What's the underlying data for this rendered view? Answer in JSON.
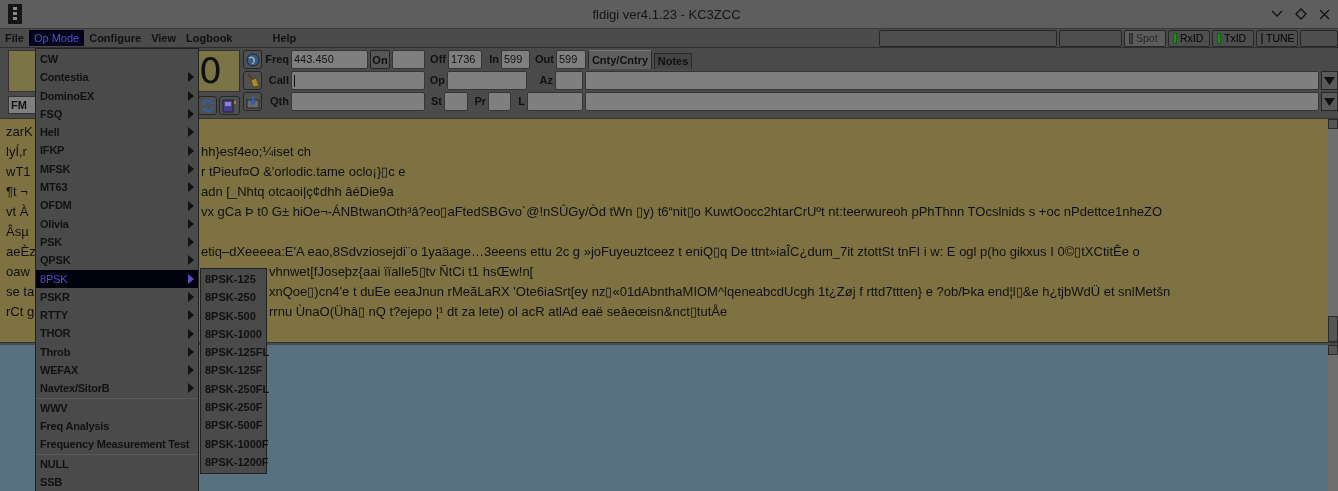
{
  "window": {
    "title": "fldigi ver4.1.23 - KC3ZCC"
  },
  "menu_bar": [
    {
      "label": "File",
      "selected": false
    },
    {
      "label": "Op Mode",
      "selected": true
    },
    {
      "label": "Configure",
      "selected": false
    },
    {
      "label": "View",
      "selected": false
    },
    {
      "label": "Logbook",
      "selected": false
    },
    {
      "label": "Help",
      "selected": false
    }
  ],
  "toolbar_buttons": [
    {
      "kind": "blank"
    },
    {
      "kind": "blank"
    },
    {
      "kind": "toggle",
      "label": "Spot",
      "on": false,
      "disabled": true
    },
    {
      "kind": "toggle",
      "label": "RxID",
      "on": true,
      "disabled": false
    },
    {
      "kind": "toggle",
      "label": "TxID",
      "on": true,
      "disabled": false
    },
    {
      "kind": "toggle",
      "label": "TUNE",
      "on": false,
      "disabled": false
    },
    {
      "kind": "blank"
    }
  ],
  "frequency_display": {
    "digit": "0"
  },
  "mode_field": {
    "value": "FM"
  },
  "log_rows": [
    [
      {
        "kind": "label",
        "text": "Freq"
      },
      {
        "kind": "field",
        "value": "443.450"
      },
      {
        "kind": "button",
        "text": "On"
      },
      {
        "kind": "field"
      },
      {
        "kind": "label",
        "text": "Off"
      },
      {
        "kind": "field",
        "value": "1736"
      },
      {
        "kind": "label",
        "text": "In"
      },
      {
        "kind": "field",
        "value": "599"
      },
      {
        "kind": "label",
        "text": "Out"
      },
      {
        "kind": "field",
        "value": "599"
      },
      {
        "kind": "tab",
        "text": "Cnty/Cntry",
        "selected": true
      },
      {
        "kind": "tab",
        "text": "Notes",
        "selected": false
      }
    ],
    [
      {
        "kind": "label",
        "text": "Call"
      },
      {
        "kind": "field",
        "focused": true
      },
      {
        "kind": "label",
        "text": "Op"
      },
      {
        "kind": "field"
      },
      {
        "kind": "label",
        "text": "Az"
      },
      {
        "kind": "field"
      },
      {
        "kind": "combo"
      }
    ],
    [
      {
        "kind": "label",
        "text": "Qth"
      },
      {
        "kind": "field"
      },
      {
        "kind": "label",
        "text": "St"
      },
      {
        "kind": "field"
      },
      {
        "kind": "label",
        "text": "Pr"
      },
      {
        "kind": "field"
      },
      {
        "kind": "label",
        "text": "L"
      },
      {
        "kind": "field"
      },
      {
        "kind": "combo"
      }
    ]
  ],
  "receive_text": [
    {
      "left": "zarK"
    },
    {
      "left": "lyÍ,r",
      "right": "hh}esf4eo;¼iset ch"
    },
    {
      "left": "wT1",
      "right": "r tPieuf¤O  &'orlodic.tame oclo¡}▯c   e"
    },
    {
      "left": "¶t ¬",
      "right": "adn [_Nhtq otcaoi|ç¢dhh âéDie9a"
    },
    {
      "left": "vt À",
      "right": "vx gCa Þ t0 G± hiOe¬-ÁNBtwanOth³â?eo▯aFtedSBGvo`@!nSÛGy/Òd  tWn ▯y) t6“nit▯o  KuwtOocc2htarCrUºt nt:teerwureoh pPhThnn TOcslnids s +oc  nPdettce1nheZO"
    },
    {
      "left": "Âsµ"
    },
    {
      "left": "aeÈz",
      "right": "etiq–dXeeeea:E'A eao,8Sdvziosejdi¨o 1yaäage…3eeens ettu 2c g »joFuyeuztceez  t eniQ▯q  De ttnt»iaÎC¿dum_7it ztottSt tnFI  i w: E ogl p(ho gikxus I 0©▯tXCtitÊe o"
    },
    {
      "left": "oaw",
      "right": "vhnwet[fJoseþz{aai ïïalle5▯tv ÑtCi  t1 hsŒw!n["
    },
    {
      "left": "se ta",
      "right": "xnQoe▯)cn4'e t  duEe eeaJnun rMeãLaRX 'Ote6iaSrt[ey nz▯«01dAbnthaMIOM^lqeneabcdUcgh  1t¿Zøj f rttd7ttten}   e ?ob/Þka end¦l▯&e h¿tjbWdÜ et snlMetšn"
    },
    {
      "left": "rCt g",
      "right": "rrnu  ÙnaO(Ühâ▯ nQ  t?ejepo ¦¹  dt za lete) ol acR atlAd eaë seâeœisn&nct▯tutÅe"
    }
  ],
  "op_mode_menu": [
    {
      "kind": "submenu",
      "label": "CW",
      "has_arrow": false,
      "selected": false
    },
    {
      "kind": "submenu",
      "label": "Contestia",
      "has_arrow": true,
      "selected": false
    },
    {
      "kind": "submenu",
      "label": "DominoEX",
      "has_arrow": true,
      "selected": false
    },
    {
      "kind": "submenu",
      "label": "FSQ",
      "has_arrow": true,
      "selected": false
    },
    {
      "kind": "submenu",
      "label": "Hell",
      "has_arrow": true,
      "selected": false
    },
    {
      "kind": "submenu",
      "label": "IFKP",
      "has_arrow": true,
      "selected": false
    },
    {
      "kind": "submenu",
      "label": "MFSK",
      "has_arrow": true,
      "selected": false
    },
    {
      "kind": "submenu",
      "label": "MT63",
      "has_arrow": true,
      "selected": false
    },
    {
      "kind": "submenu",
      "label": "OFDM",
      "has_arrow": true,
      "selected": false
    },
    {
      "kind": "submenu",
      "label": "Olivia",
      "has_arrow": true,
      "selected": false
    },
    {
      "kind": "submenu",
      "label": "PSK",
      "has_arrow": true,
      "selected": false
    },
    {
      "kind": "submenu",
      "label": "QPSK",
      "has_arrow": true,
      "selected": false
    },
    {
      "kind": "submenu",
      "label": "8PSK",
      "has_arrow": true,
      "selected": true
    },
    {
      "kind": "submenu",
      "label": "PSKR",
      "has_arrow": true,
      "selected": false
    },
    {
      "kind": "submenu",
      "label": "RTTY",
      "has_arrow": true,
      "selected": false
    },
    {
      "kind": "submenu",
      "label": "THOR",
      "has_arrow": true,
      "selected": false
    },
    {
      "kind": "submenu",
      "label": "Throb",
      "has_arrow": true,
      "selected": false
    },
    {
      "kind": "submenu",
      "label": "WEFAX",
      "has_arrow": true,
      "selected": false
    },
    {
      "kind": "submenu",
      "label": "Navtex/SitorB",
      "has_arrow": true,
      "selected": false
    },
    {
      "kind": "separator"
    },
    {
      "kind": "submenu",
      "label": "WWV",
      "has_arrow": false,
      "selected": false
    },
    {
      "kind": "submenu",
      "label": "Freq Analysis",
      "has_arrow": false,
      "selected": false
    },
    {
      "kind": "submenu",
      "label": "Frequency Measurement Test",
      "has_arrow": false,
      "selected": false
    },
    {
      "kind": "separator"
    },
    {
      "kind": "submenu",
      "label": "NULL",
      "has_arrow": false,
      "selected": false
    },
    {
      "kind": "submenu",
      "label": "SSB",
      "has_arrow": false,
      "selected": false
    }
  ],
  "submenu_8psk": [
    "8PSK-125",
    "8PSK-250",
    "8PSK-500",
    "8PSK-1000",
    "8PSK-125FL",
    "8PSK-125F",
    "8PSK-250FL",
    "8PSK-250F",
    "8PSK-500F",
    "8PSK-1000F",
    "8PSK-1200F"
  ]
}
